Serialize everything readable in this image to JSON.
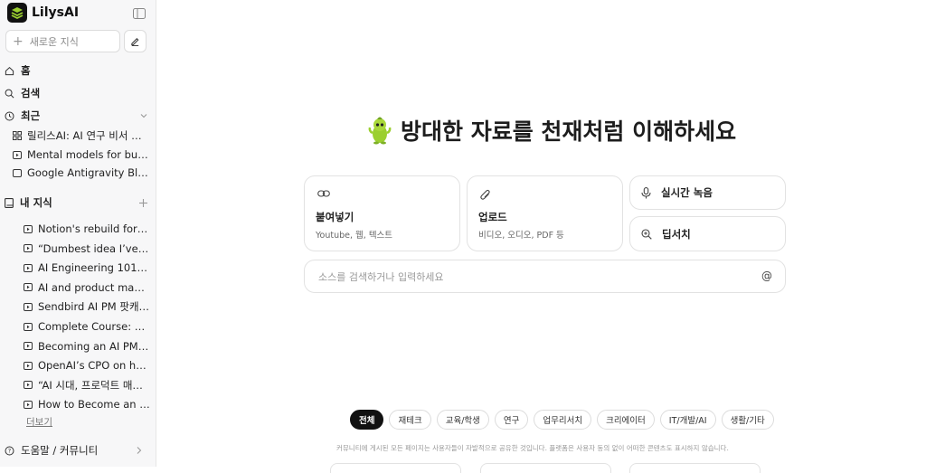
{
  "app": {
    "logo_text": "LilysAI"
  },
  "sidebar": {
    "new_knowledge_placeholder": "새로운 지식",
    "nav": {
      "home": "홈",
      "search": "검색",
      "recent": "최근",
      "my_knowledge": "내 지식"
    },
    "recent_items": [
      {
        "icon": "grid-icon",
        "label": "릴리스AI: AI 연구 비서 활용..."
      },
      {
        "icon": "video-icon",
        "label": "Mental models for buildi..."
      },
      {
        "icon": "web-icon",
        "label": "Google Antigravity Blog: ..."
      }
    ],
    "knowledge_items": [
      {
        "icon": "video-icon",
        "label": "Notion's rebuild for ag..."
      },
      {
        "icon": "video-icon",
        "label": "“Dumbest idea I’ve he..."
      },
      {
        "icon": "video-icon",
        "label": "AI Engineering 101 wit..."
      },
      {
        "icon": "video-icon",
        "label": "AI and product manag..."
      },
      {
        "icon": "video-icon",
        "label": "Sendbird AI PM 팟캐스..."
      },
      {
        "icon": "video-icon",
        "label": "Complete Course: AI ..."
      },
      {
        "icon": "video-icon",
        "label": "Becoming an AI PM | ..."
      },
      {
        "icon": "video-icon",
        "label": "OpenAI’s CPO on how..."
      },
      {
        "icon": "video-icon",
        "label": "“AI 시대, 프로덕트 매니..."
      },
      {
        "icon": "video-icon",
        "label": "How to Become an AI ..."
      }
    ],
    "more_label": "더보기",
    "help_label": "도움말 / 커뮤니티"
  },
  "main": {
    "title": "방대한 자료를 천재처럼 이해하세요",
    "paste_card": {
      "title": "붙여넣기",
      "subtitle": "Youtube, 웹, 텍스트"
    },
    "upload_card": {
      "title": "업로드",
      "subtitle": "비디오, 오디오, PDF 등"
    },
    "record_label": "실시간 녹음",
    "deep_search_label": "딥서치",
    "search_placeholder": "소스를 검색하거나 입력하세요",
    "search_at": "@",
    "chips": [
      "전체",
      "재테크",
      "교육/학생",
      "연구",
      "업무리서치",
      "크리에이터",
      "IT/개발/AI",
      "생활/기타"
    ],
    "active_chip": "전체",
    "footnote": "커뮤니티에 게시된 모든 페이지는 사용자들이 자발적으로 공유한 것입니다. 플랫폼은 사용자 동의 없이 어떠한 콘텐츠도 표시하지 않습니다."
  },
  "colors": {
    "brand_green": "#9bcf2f",
    "active_chip": "#111111",
    "sidebar_bg": "#f7f7f8"
  }
}
